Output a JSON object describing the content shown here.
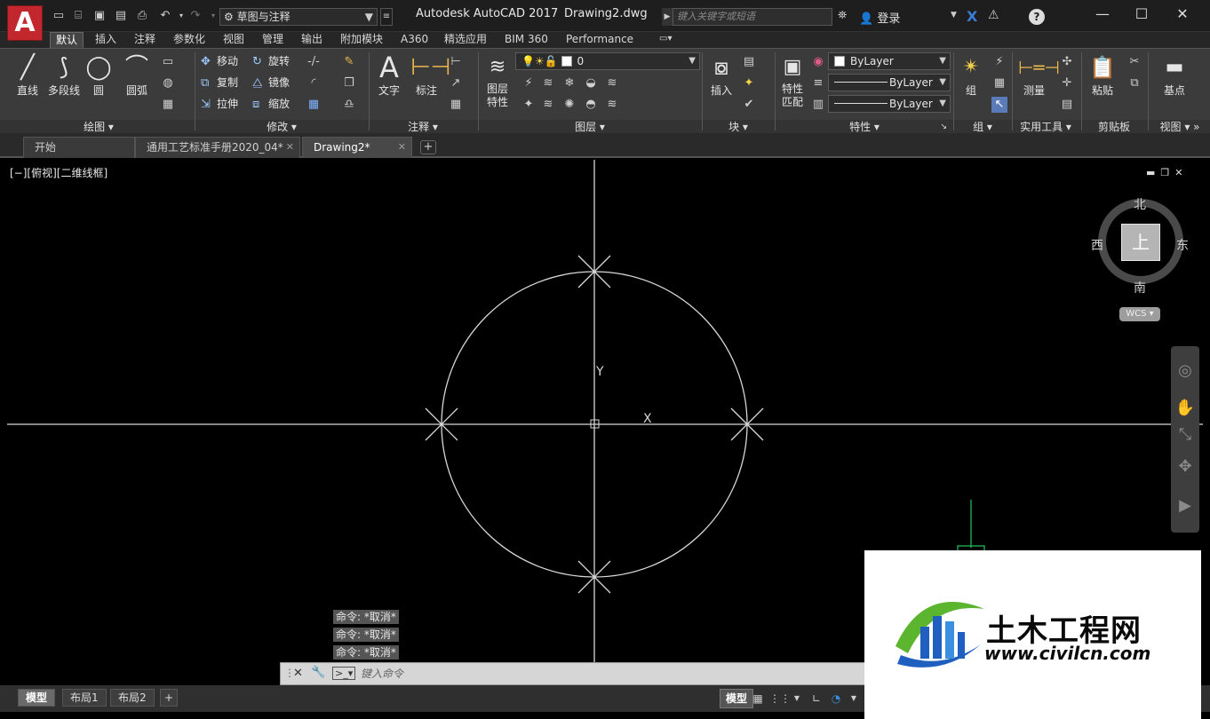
{
  "titlebar": {
    "logo_letter": "A",
    "workspace": "草图与注释",
    "app_title": "Autodesk AutoCAD 2017",
    "doc_title": "Drawing2.dwg",
    "search_placeholder": "键入关键字或短语",
    "login": "登录",
    "help": "?"
  },
  "ribbon_tabs": [
    "默认",
    "插入",
    "注释",
    "参数化",
    "视图",
    "管理",
    "输出",
    "附加模块",
    "A360",
    "精选应用",
    "BIM 360",
    "Performance"
  ],
  "ribbon": {
    "draw": {
      "title": "绘图",
      "line": "直线",
      "polyline": "多段线",
      "circle": "圆",
      "arc": "圆弧"
    },
    "modify": {
      "title": "修改",
      "move": "移动",
      "rotate": "旋转",
      "copy": "复制",
      "mirror": "镜像",
      "stretch": "拉伸",
      "scale": "缩放"
    },
    "annotation": {
      "title": "注释",
      "text": "文字",
      "dimension": "标注"
    },
    "layers": {
      "title": "图层",
      "properties_line1": "图层",
      "properties_line2": "特性",
      "current_layer": "0"
    },
    "block": {
      "title": "块",
      "insert": "插入"
    },
    "properties": {
      "title": "特性",
      "match_line1": "特性",
      "match_line2": "匹配",
      "color": "ByLayer",
      "linetype": "ByLayer",
      "lineweight": "ByLayer"
    },
    "groups": {
      "title": "组",
      "group": "组"
    },
    "utilities": {
      "title": "实用工具",
      "measure": "测量"
    },
    "clipboard": {
      "title": "剪贴板",
      "paste": "粘贴"
    },
    "view": {
      "title": "视图",
      "base": "基点"
    }
  },
  "doc_tabs": [
    "开始",
    "通用工艺标准手册2020_04*",
    "Drawing2*"
  ],
  "viewport_label": "[−][俯视][二维线框]",
  "viewcube": {
    "north": "北",
    "south": "南",
    "east": "东",
    "west": "西",
    "face": "上",
    "wcs": "WCS"
  },
  "ucs": {
    "y_label": "Y",
    "x_label": "X"
  },
  "command_history": [
    "命令: *取消*",
    "命令: *取消*",
    "命令: *取消*"
  ],
  "command_placeholder": "键入命令",
  "layout_tabs": [
    "模型",
    "布局1",
    "布局2"
  ],
  "status": {
    "model": "模型"
  },
  "watermark": {
    "main": "土木工程网",
    "url": "www.civilcn.com"
  },
  "colors": {
    "accent_red": "#c1272d",
    "wcs_y_axis": "#22c55e",
    "logo_blue": "#1f5fbf",
    "logo_green": "#5bb52f"
  }
}
